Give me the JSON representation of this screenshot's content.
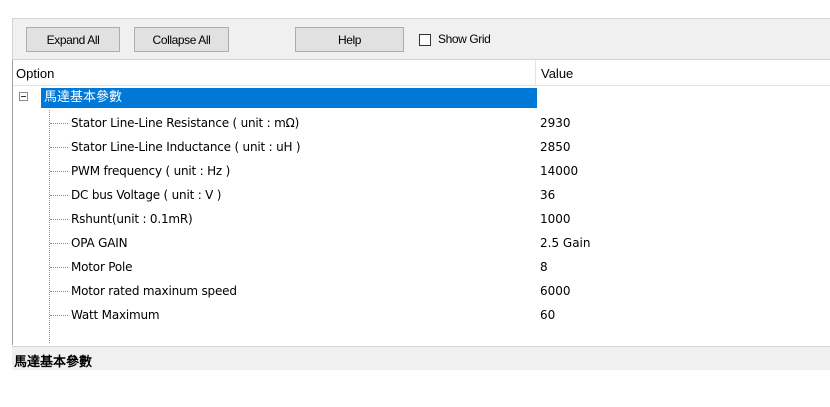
{
  "toolbar": {
    "expand_all": "Expand All",
    "collapse_all": "Collapse All",
    "help": "Help",
    "show_grid_label": "Show Grid",
    "show_grid_checked": false
  },
  "grid": {
    "columns": {
      "option": "Option",
      "value": "Value"
    },
    "group": {
      "label": "馬達基本參數",
      "expanded": true
    },
    "rows": [
      {
        "name": "Stator Line-Line Resistance ( unit : mΩ)",
        "value": "2930"
      },
      {
        "name": "Stator Line-Line Inductance ( unit : uH )",
        "value": "2850"
      },
      {
        "name": "PWM frequency ( unit : Hz )",
        "value": "14000"
      },
      {
        "name": "DC bus Voltage ( unit : V )",
        "value": "36"
      },
      {
        "name": "Rshunt(unit : 0.1mR)",
        "value": "1000"
      },
      {
        "name": "OPA GAIN",
        "value": "2.5 Gain"
      },
      {
        "name": "Motor Pole",
        "value": "8"
      },
      {
        "name": "Motor rated maxinum speed",
        "value": "6000"
      },
      {
        "name": "Watt Maximum",
        "value": "60"
      }
    ]
  },
  "description": {
    "title": "馬達基本參數"
  },
  "colors": {
    "selection": "#0078d7",
    "toolbar_bg": "#f0f0f0"
  }
}
